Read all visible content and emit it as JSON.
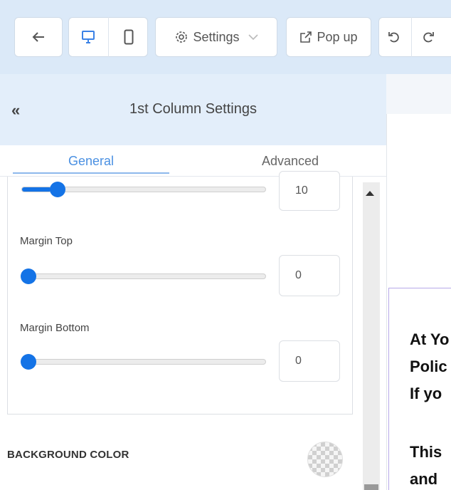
{
  "toolbar": {
    "back_icon": "arrow-left-icon",
    "desktop_icon": "monitor-icon",
    "mobile_icon": "phone-icon",
    "settings_label": "Settings",
    "popup_label": "Pop up",
    "undo_icon": "undo-icon",
    "redo_icon": "redo-icon"
  },
  "panel": {
    "collapse_label": "«",
    "title": "1st Column Settings",
    "tabs": [
      {
        "label": "General",
        "active": true
      },
      {
        "label": "Advanced",
        "active": false
      }
    ]
  },
  "fields": {
    "top_slider": {
      "value": "10",
      "fraction": 0.12
    },
    "margin_top": {
      "label": "Margin Top",
      "value": "0",
      "fraction": 0.0
    },
    "margin_bottom": {
      "label": "Margin Bottom",
      "value": "0",
      "fraction": 0.0
    }
  },
  "background": {
    "label": "BACKGROUND COLOR"
  },
  "preview": {
    "lines": [
      "At Yo",
      "Polic",
      "If yo",
      "",
      "This",
      "and"
    ]
  },
  "colors": {
    "accent": "#1473e6",
    "toolbar_bg": "#dbe9f8",
    "tab_active": "#4a90e2"
  }
}
